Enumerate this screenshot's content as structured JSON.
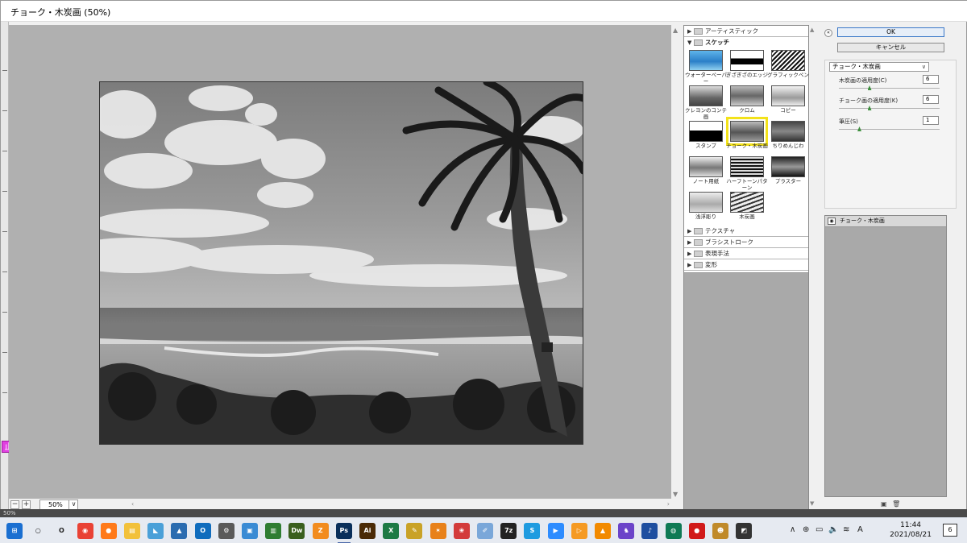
{
  "window": {
    "title": "チョーク・木炭画 (50%)"
  },
  "zoom": {
    "value": "50%",
    "minus": "−",
    "plus": "+",
    "caret": "∨"
  },
  "gallery": {
    "categories_top": [
      {
        "label": "アーティスティック"
      },
      {
        "label": "スケッチ"
      }
    ],
    "sketch_filters": [
      {
        "label": "ウォーターペーパー"
      },
      {
        "label": "ぎざぎざのエッジ"
      },
      {
        "label": "グラフィックペン"
      },
      {
        "label": "クレヨンのコンテ画"
      },
      {
        "label": "クロム"
      },
      {
        "label": "コピー"
      },
      {
        "label": "スタンプ"
      },
      {
        "label": "チョーク・木炭画"
      },
      {
        "label": "ちりめんじわ"
      },
      {
        "label": "ノート用紙"
      },
      {
        "label": "ハーフトーンパターン"
      },
      {
        "label": "プラスター"
      },
      {
        "label": "浅浮彫り"
      },
      {
        "label": "木炭画"
      }
    ],
    "categories_bottom": [
      {
        "label": "テクスチャ"
      },
      {
        "label": "ブラシストローク"
      },
      {
        "label": "表現手法"
      },
      {
        "label": "変形"
      }
    ],
    "selected": "チョーク・木炭画"
  },
  "actions": {
    "ok": "OK",
    "cancel": "キャンセル"
  },
  "params": {
    "filter_select": "チョーク・木炭画",
    "items": [
      {
        "label": "木炭画の適用度(C)",
        "value": "6",
        "fraction": 0.3
      },
      {
        "label": "チョーク画の適用度(K)",
        "value": "6",
        "fraction": 0.3
      },
      {
        "label": "筆圧(S)",
        "value": "1",
        "fraction": 0.2
      }
    ]
  },
  "layers": {
    "row_label": "チョーク・木炭画"
  },
  "ruler": {
    "badge": "止"
  },
  "statusbar": {
    "zoom": "50%"
  },
  "taskbar": {
    "clock_time": "11:44",
    "clock_date": "2021/08/21",
    "ime": "A",
    "notifications": "6",
    "apps": [
      {
        "name": "windows",
        "color": "#1a6fd1",
        "glyph": "⊞"
      },
      {
        "name": "search",
        "color": "#e6eaf1",
        "glyph": "○"
      },
      {
        "name": "cortana",
        "color": "#e6eaf1",
        "glyph": "O"
      },
      {
        "name": "chrome",
        "color": "#e94235",
        "glyph": "◉"
      },
      {
        "name": "firefox",
        "color": "#ff7a1a",
        "glyph": "●"
      },
      {
        "name": "explorer",
        "color": "#f2c13b",
        "glyph": "▤"
      },
      {
        "name": "app5",
        "color": "#4aa0d8",
        "glyph": "◣"
      },
      {
        "name": "photos",
        "color": "#2b6cb0",
        "glyph": "▲"
      },
      {
        "name": "outlook",
        "color": "#0f6cbd",
        "glyph": "O"
      },
      {
        "name": "settings",
        "color": "#5a5a5a",
        "glyph": "⚙"
      },
      {
        "name": "app10",
        "color": "#3a8bd4",
        "glyph": "▣"
      },
      {
        "name": "app11",
        "color": "#2f7d32",
        "glyph": "▥"
      },
      {
        "name": "dreamweaver",
        "color": "#3a5f1e",
        "glyph": "Dw"
      },
      {
        "name": "app13",
        "color": "#f28c1f",
        "glyph": "Z"
      },
      {
        "name": "photoshop",
        "color": "#0a2f5a",
        "glyph": "Ps"
      },
      {
        "name": "illustrator",
        "color": "#4a2a06",
        "glyph": "Ai"
      },
      {
        "name": "excel",
        "color": "#1d7a45",
        "glyph": "X"
      },
      {
        "name": "app17",
        "color": "#c9a227",
        "glyph": "✎"
      },
      {
        "name": "app18",
        "color": "#e8811a",
        "glyph": "✶"
      },
      {
        "name": "app19",
        "color": "#d33b3b",
        "glyph": "❀"
      },
      {
        "name": "app20",
        "color": "#7aa7d9",
        "glyph": "✐"
      },
      {
        "name": "7zip",
        "color": "#222222",
        "glyph": "7z"
      },
      {
        "name": "skype",
        "color": "#1e9be0",
        "glyph": "S"
      },
      {
        "name": "zoom",
        "color": "#2d8cff",
        "glyph": "▶"
      },
      {
        "name": "app24",
        "color": "#f59a23",
        "glyph": "▷"
      },
      {
        "name": "vlc",
        "color": "#f28a00",
        "glyph": "▲"
      },
      {
        "name": "app26",
        "color": "#6b44c9",
        "glyph": "♞"
      },
      {
        "name": "app27",
        "color": "#1f4fa0",
        "glyph": "♪"
      },
      {
        "name": "app28",
        "color": "#0e7a55",
        "glyph": "◍"
      },
      {
        "name": "app29",
        "color": "#d11a1a",
        "glyph": "●"
      },
      {
        "name": "app30",
        "color": "#c08a2a",
        "glyph": "☻"
      },
      {
        "name": "app31",
        "color": "#333333",
        "glyph": "◩"
      }
    ]
  }
}
